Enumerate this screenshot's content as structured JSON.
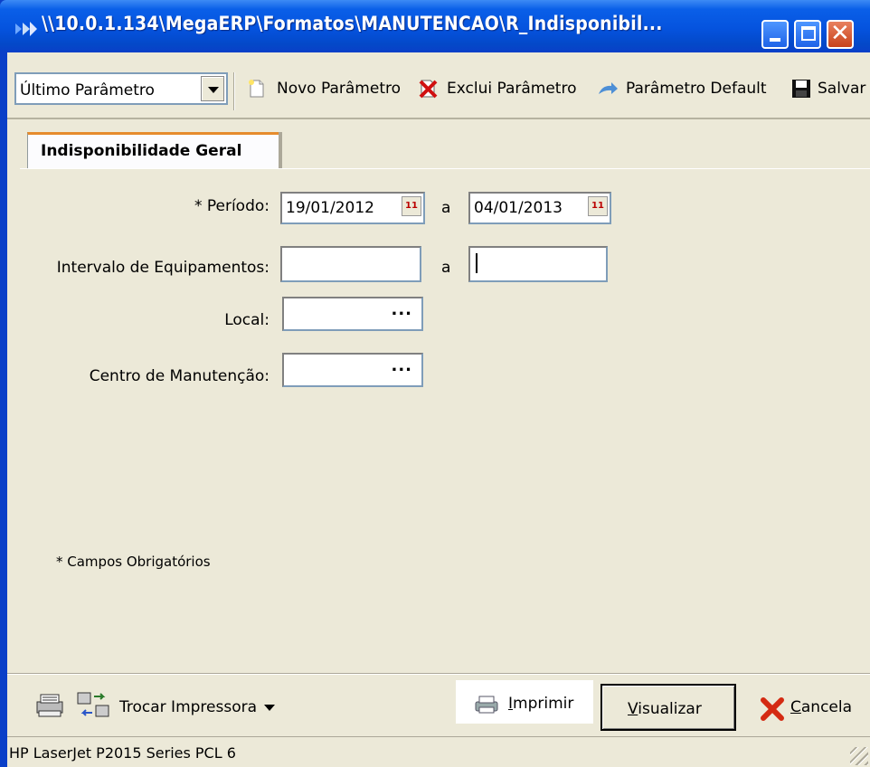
{
  "window": {
    "title": "\\\\10.0.1.134\\MegaERP\\Formatos\\MANUTENCAO\\R_Indisponibil...",
    "icons": [
      "app-icon",
      "minimize-icon",
      "maximize-icon",
      "close-icon"
    ]
  },
  "toolbar": {
    "combo_value": "Último Parâmetro",
    "new_label": "Novo Parâmetro",
    "delete_label": "Exclui Parâmetro",
    "default_label": "Parâmetro Default",
    "save_label": "Salvar"
  },
  "tabs": [
    {
      "label": "Indisponibilidade Geral",
      "active": true
    }
  ],
  "form": {
    "periodo_label": "* Período:",
    "periodo_from": "19/01/2012",
    "periodo_to": "04/01/2013",
    "range_sep": "a",
    "equip_label": "Intervalo de Equipamentos:",
    "equip_from": "",
    "equip_to": "",
    "local_label": "Local:",
    "local_value": "",
    "centro_label": "Centro de Manutenção:",
    "centro_value": "",
    "lookup_glyph": "...",
    "calendar_glyph": "11"
  },
  "note": "* Campos Obrigatórios",
  "bottom": {
    "troca_label": "Trocar Impressora",
    "imprimir_first": "I",
    "imprimir_rest": "mprimir",
    "visualizar_first": "V",
    "visualizar_rest": "isualizar",
    "cancela_first": "C",
    "cancela_rest": "ancela"
  },
  "status": {
    "printer": "HP LaserJet P2015 Series PCL 6"
  },
  "colors": {
    "titlebar": "#0553de",
    "face": "#ece9d8",
    "tab_accent": "#e68b2c",
    "field_border": "#7f9db9"
  }
}
